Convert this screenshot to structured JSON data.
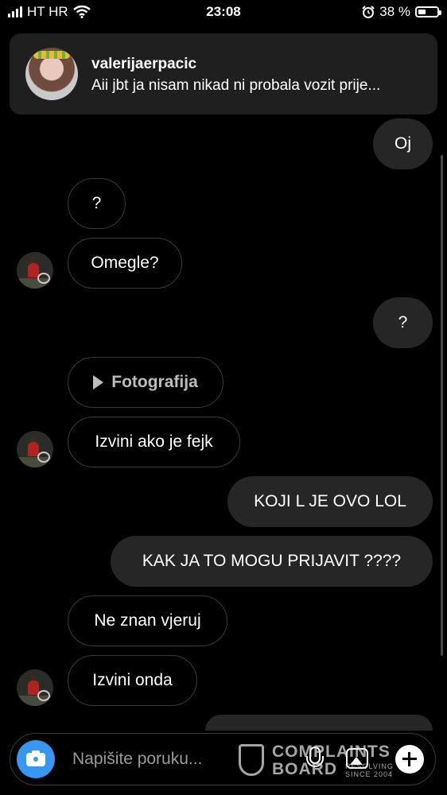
{
  "status_bar": {
    "carrier": "HT HR",
    "time": "23:08",
    "battery": "38 %"
  },
  "notification": {
    "username": "valerijaerpacic",
    "message": "Aii jbt ja nisam nikad ni probala vozit prije..."
  },
  "messages": [
    {
      "side": "out",
      "text": "Oj"
    },
    {
      "side": "in",
      "text": "?"
    },
    {
      "side": "in",
      "text": "Omegle?"
    },
    {
      "side": "out",
      "text": "?"
    },
    {
      "side": "in",
      "type": "photo",
      "text": "Fotografija"
    },
    {
      "side": "in",
      "text": "Izvini ako je fejk"
    },
    {
      "side": "out",
      "text": "KOJI L JE OVO LOL"
    },
    {
      "side": "out",
      "text": "KAK JA TO MOGU PRIJAVIT ????"
    },
    {
      "side": "in",
      "text": "Ne znan vjeruj"
    },
    {
      "side": "in",
      "text": "Izvini onda"
    }
  ],
  "composer": {
    "placeholder": "Napišite poruku..."
  },
  "watermark": {
    "line1": "COMPLAINTS",
    "line2": "BOARD",
    "tag1": "RESOLVING",
    "tag2": "SINCE 2004"
  },
  "icons": [
    "signal-icon",
    "wifi-icon",
    "alarm-icon",
    "battery-icon",
    "camera-icon",
    "microphone-icon",
    "gallery-icon",
    "plus-icon",
    "play-icon"
  ]
}
